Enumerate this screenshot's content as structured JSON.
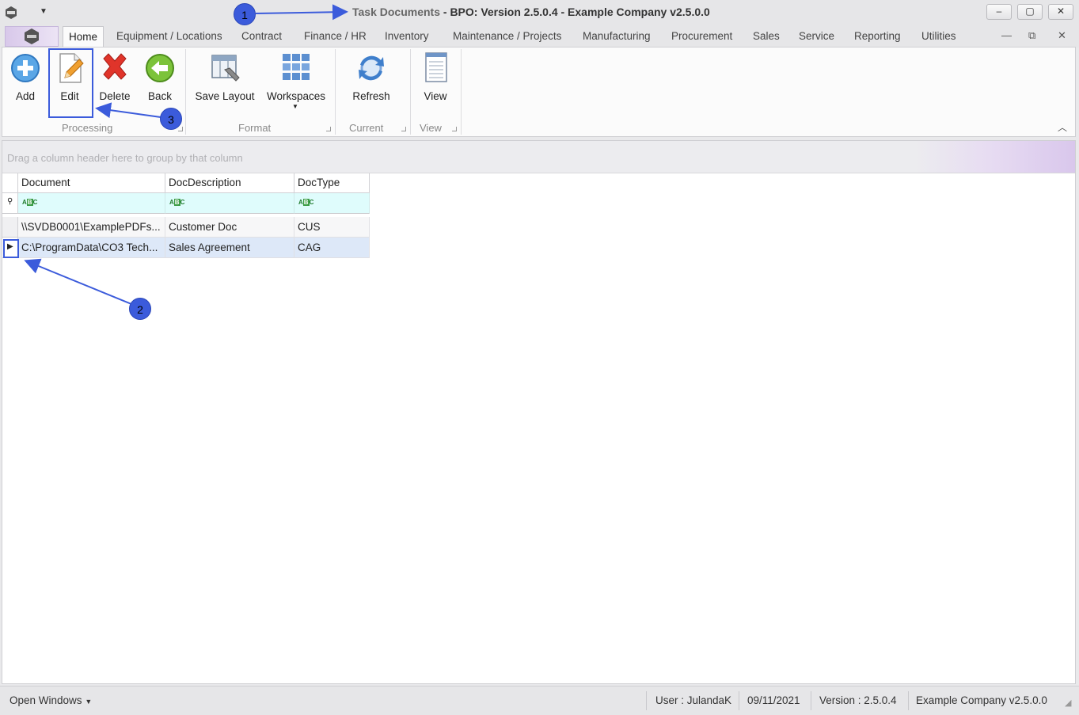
{
  "window": {
    "title_part1": "Task Documents",
    "title_part2": " - BPO: Version 2.5.0.4 - Example Company v2.5.0.0",
    "minimize": "–",
    "restore": "▢",
    "close": "✕"
  },
  "ribbon": {
    "tabs": [
      "Home",
      "Equipment / Locations",
      "Contract",
      "Finance / HR",
      "Inventory",
      "Maintenance / Projects",
      "Manufacturing",
      "Procurement",
      "Sales",
      "Service",
      "Reporting",
      "Utilities"
    ],
    "active_tab": "Home",
    "groups": {
      "processing": {
        "label": "Processing",
        "buttons": {
          "add": "Add",
          "edit": "Edit",
          "delete": "Delete",
          "back": "Back"
        }
      },
      "format": {
        "label": "Format",
        "buttons": {
          "save_layout": "Save Layout",
          "workspaces": "Workspaces"
        }
      },
      "current": {
        "label": "Current",
        "buttons": {
          "refresh": "Refresh"
        }
      },
      "view": {
        "label": "View",
        "buttons": {
          "view": "View"
        }
      }
    }
  },
  "grid": {
    "group_panel_hint": "Drag a column header here to group by that column",
    "columns": [
      "Document",
      "DocDescription",
      "DocType"
    ],
    "rows": [
      {
        "document": "\\\\SVDB0001\\ExamplePDFs...",
        "description": "Customer Doc",
        "type": "CUS"
      },
      {
        "document": "C:\\ProgramData\\CO3 Tech...",
        "description": "Sales Agreement",
        "type": "CAG"
      }
    ]
  },
  "statusbar": {
    "open_windows": "Open Windows",
    "user": "User : JulandaK",
    "date": "09/11/2021",
    "version": "Version : 2.5.0.4",
    "company": "Example Company v2.5.0.0"
  },
  "annotations": {
    "badge1": "1",
    "badge2": "2",
    "badge3": "3"
  },
  "colors": {
    "annotation": "#3b5bdb",
    "filter_row": "#dffcfc",
    "selected_row": "#dde8f8"
  }
}
